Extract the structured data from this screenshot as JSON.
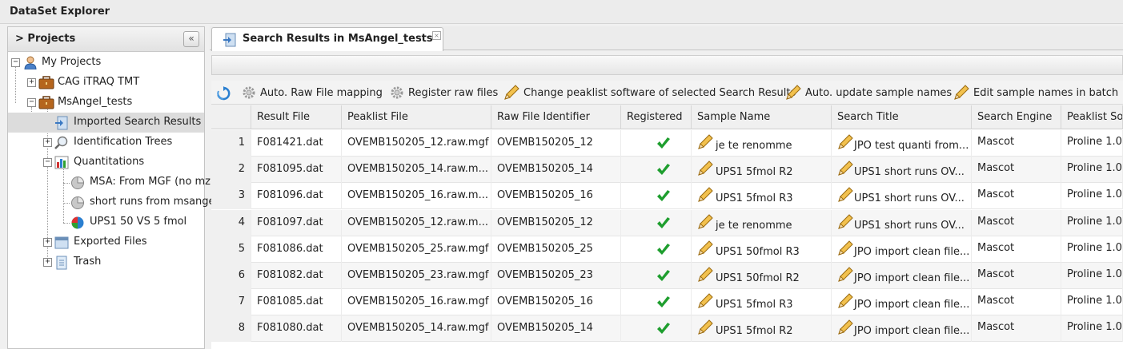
{
  "app": {
    "title": "DataSet Explorer"
  },
  "projects_panel": {
    "title": "> Projects",
    "collapse_glyph": "«",
    "tree": [
      {
        "label": "My Projects",
        "icon": "user-icon",
        "expander": "−"
      },
      {
        "label": "CAG iTRAQ TMT",
        "icon": "briefcase-icon",
        "expander": "+"
      },
      {
        "label": "MsAngel_tests",
        "icon": "briefcase-icon",
        "expander": "−"
      },
      {
        "label": "Imported Search Results",
        "icon": "import-icon",
        "expander": ""
      },
      {
        "label": "Identification Trees",
        "icon": "magnifier-icon",
        "expander": "+"
      },
      {
        "label": "Quantitations",
        "icon": "bar-chart-icon",
        "expander": "−"
      },
      {
        "label": "MSA: From MGF (no mz",
        "icon": "pie-gray-icon",
        "expander": ""
      },
      {
        "label": "short runs from msange",
        "icon": "pie-gray-icon",
        "expander": ""
      },
      {
        "label": "UPS1 50 VS 5 fmol",
        "icon": "pie-color-icon",
        "expander": ""
      },
      {
        "label": "Exported Files",
        "icon": "export-icon",
        "expander": "+"
      },
      {
        "label": "Trash",
        "icon": "trash-icon",
        "expander": "+"
      }
    ]
  },
  "tab": {
    "label": "Search Results in MsAngel_tests",
    "close": "×"
  },
  "toolbar": {
    "refresh": "",
    "auto_raw": "Auto. Raw File mapping",
    "register_raw": "Register raw files",
    "change_peaklist": "Change peaklist software of selected Search Results",
    "auto_update": "Auto. update sample names",
    "edit_batch": "Edit sample names in batch"
  },
  "table": {
    "columns": [
      "Result File",
      "Peaklist File",
      "Raw File Identifier",
      "Registered",
      "Sample Name",
      "Search Title",
      "Search Engine",
      "Peaklist Sof"
    ],
    "rows": [
      {
        "n": "1",
        "result": "F081421.dat",
        "peaklist": "OVEMB150205_12.raw.mgf",
        "raw": "OVEMB150205_12",
        "sample": "je te renomme",
        "title": "JPO test quanti from...",
        "engine": "Mascot",
        "software": "Proline 1.0"
      },
      {
        "n": "2",
        "result": "F081095.dat",
        "peaklist": "OVEMB150205_14.raw.m...",
        "raw": "OVEMB150205_14",
        "sample": "UPS1 5fmol R2",
        "title": "UPS1 short runs OV...",
        "engine": "Mascot",
        "software": "Proline 1.0"
      },
      {
        "n": "3",
        "result": "F081096.dat",
        "peaklist": "OVEMB150205_16.raw.m...",
        "raw": "OVEMB150205_16",
        "sample": "UPS1 5fmol R3",
        "title": "UPS1 short runs OV...",
        "engine": "Mascot",
        "software": "Proline 1.0"
      },
      {
        "n": "4",
        "result": "F081097.dat",
        "peaklist": "OVEMB150205_12.raw.m...",
        "raw": "OVEMB150205_12",
        "sample": "je te renomme",
        "title": "UPS1 short runs OV...",
        "engine": "Mascot",
        "software": "Proline 1.0"
      },
      {
        "n": "5",
        "result": "F081086.dat",
        "peaklist": "OVEMB150205_25.raw.mgf",
        "raw": "OVEMB150205_25",
        "sample": "UPS1 50fmol R3",
        "title": "JPO import clean file...",
        "engine": "Mascot",
        "software": "Proline 1.0"
      },
      {
        "n": "6",
        "result": "F081082.dat",
        "peaklist": "OVEMB150205_23.raw.mgf",
        "raw": "OVEMB150205_23",
        "sample": "UPS1 50fmol R2",
        "title": "JPO import clean file...",
        "engine": "Mascot",
        "software": "Proline 1.0"
      },
      {
        "n": "7",
        "result": "F081085.dat",
        "peaklist": "OVEMB150205_16.raw.mgf",
        "raw": "OVEMB150205_16",
        "sample": "UPS1 5fmol R3",
        "title": "JPO import clean file...",
        "engine": "Mascot",
        "software": "Proline 1.0"
      },
      {
        "n": "8",
        "result": "F081080.dat",
        "peaklist": "OVEMB150205_14.raw.mgf",
        "raw": "OVEMB150205_14",
        "sample": "UPS1 5fmol R2",
        "title": "JPO import clean file...",
        "engine": "Mascot",
        "software": "Proline 1.0"
      }
    ]
  },
  "colors": {
    "check": "#1e9e2e",
    "pencil": "#e0a020",
    "selection": "#dcdcdc"
  }
}
